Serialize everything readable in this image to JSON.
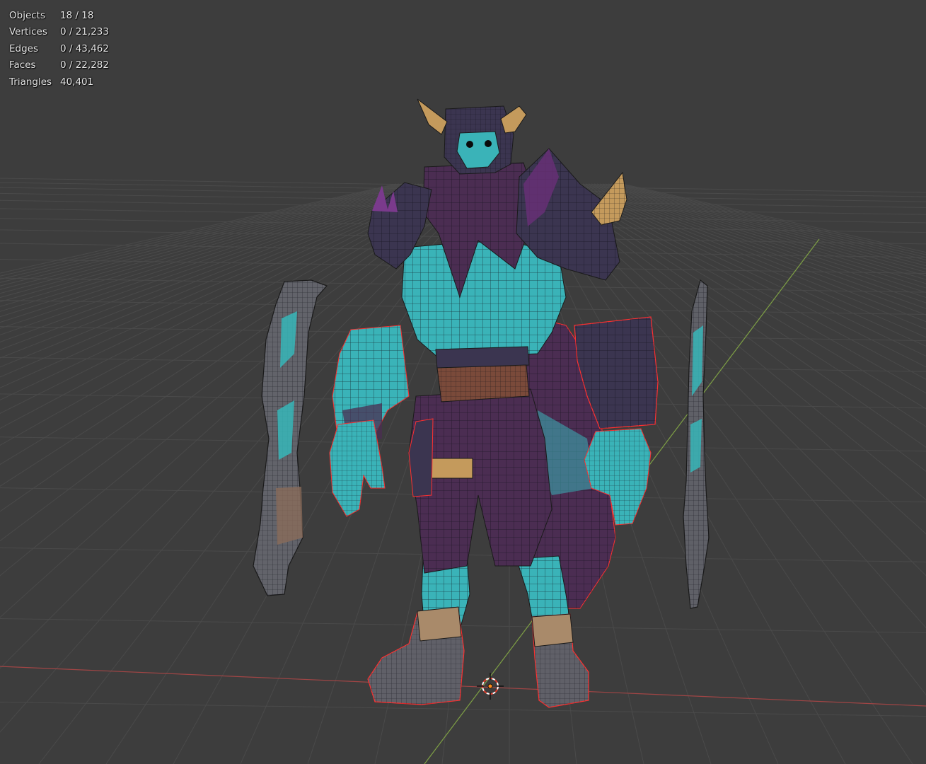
{
  "stats": [
    {
      "label": "Objects",
      "value": "18 / 18"
    },
    {
      "label": "Vertices",
      "value": "0 / 21,233"
    },
    {
      "label": "Edges",
      "value": "0 / 43,462"
    },
    {
      "label": "Faces",
      "value": "0 / 22,282"
    },
    {
      "label": "Triangles",
      "value": "40,401"
    }
  ],
  "colors": {
    "background": "#3d3d3d",
    "grid": "#4a4a4a",
    "x_axis": "#b04a4a",
    "y_axis": "#7da042",
    "skin": "#3ab3b8",
    "cloth": "#4b2d52",
    "armor": "#3b3550",
    "horn": "#c49a5c",
    "metal": "#6e6e6e",
    "selection_outline": "#ff3030",
    "cursor": "#ff8c1a"
  }
}
